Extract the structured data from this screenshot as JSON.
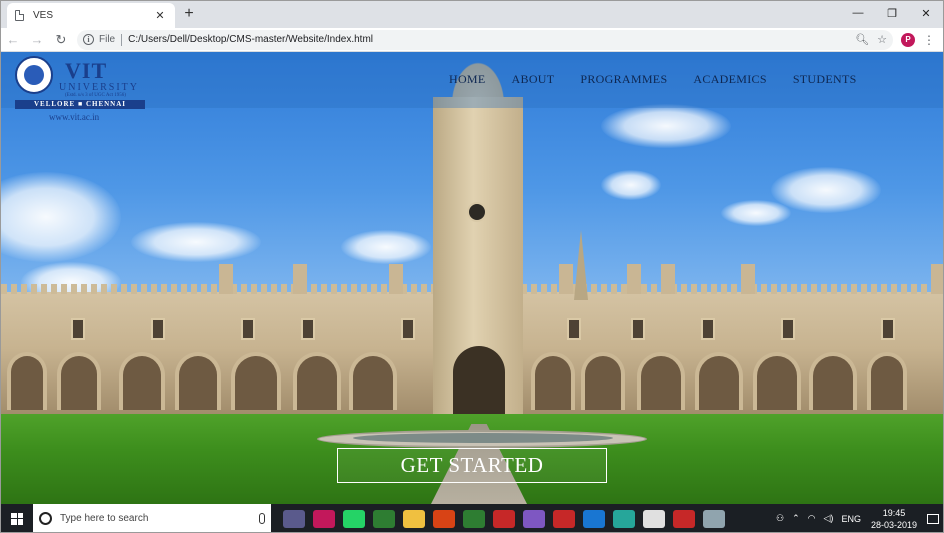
{
  "browser": {
    "tab_title": "VES",
    "tab_close": "✕",
    "new_tab": "+",
    "window_controls": {
      "minimize": "—",
      "restore": "❐",
      "close": "✕"
    },
    "nav": {
      "back": "←",
      "forward": "→",
      "reload": "↻"
    },
    "address": {
      "scheme_label": "File",
      "url": "C:/Users/Dell/Desktop/CMS-master/Website/Index.html"
    },
    "profile_initial": "P",
    "menu": "⋮"
  },
  "site": {
    "logo": {
      "name": "VIT",
      "subtitle": "UNIVERSITY",
      "established": "(Estd. u/s 3 of UGC Act 1956)",
      "campus": "VELLORE  ■  CHENNAI",
      "website": "www.vit.ac.in"
    },
    "nav": [
      "HOME",
      "ABOUT",
      "PROGRAMMES",
      "ACADEMICS",
      "STUDENTS"
    ],
    "cta_label": "GET STARTED"
  },
  "taskbar": {
    "search_placeholder": "Type here to search",
    "language": "ENG",
    "time": "19:45",
    "date": "28-03-2019",
    "app_colors": [
      "#5a5a8c",
      "#c2185b",
      "#25d366",
      "#2e7d32",
      "#f0c040",
      "#d84315",
      "#2e7d32",
      "#c62828",
      "#7e57c2",
      "#c62828",
      "#1976d2",
      "#26a69a",
      "#e0e0e0",
      "#c62828",
      "#90a4ae"
    ]
  }
}
